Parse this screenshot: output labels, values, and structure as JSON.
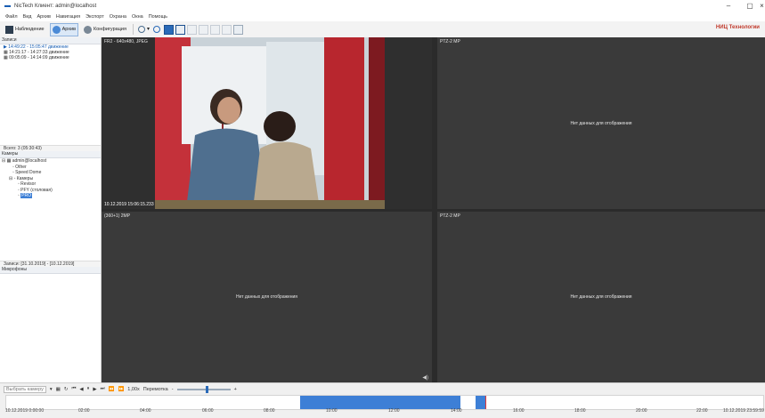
{
  "window": {
    "title": "NicTech Клиент: admin@localhost",
    "brand": "НИЦ Технологии"
  },
  "menu": [
    "Файл",
    "Вид",
    "Архив",
    "Навигация",
    "Экспорт",
    "Охрана",
    "Окна",
    "Помощь"
  ],
  "toolbar": {
    "observe": "Наблюдение",
    "archive": "Архив",
    "config": "Конфигурация"
  },
  "records": {
    "header": "Записи",
    "items": [
      "14:49:22 - 15:05:47 движение",
      "14:21:17 - 14:27:33 движение",
      "09:05:09 - 14:14:09 движение"
    ],
    "total": "Всего: 3 (05:30:43)"
  },
  "cameras": {
    "header": "Камеры",
    "tree": [
      "admin@localhost",
      "Other",
      "Speed Dome",
      "Камеры",
      "Revisor",
      "PFY (столовая)",
      "PRO"
    ],
    "range": "Записи: [31.10.2019] - [10.12.2019]",
    "mics": "Микрофоны"
  },
  "cells": [
    {
      "name": "FR2 - 640x480, JPEG",
      "timestamp": "10.12.2019 15:06:15.233"
    },
    {
      "name": "PTZ-2 MP",
      "nodata": "Нет данных для отображения"
    },
    {
      "name": "(360+1) 2MP",
      "nodata": "Нет данных для отображения"
    },
    {
      "name": "PTZ-2 MP",
      "nodata": "Нет данных для отображения"
    }
  ],
  "controls": {
    "select_camera": "Выбрать камеру",
    "speed": "1,00х",
    "rewind": "Перемотка"
  },
  "timeline": {
    "start": "10.12.2019 0:00:00",
    "end": "10.12.2019 23:59:59",
    "ticks": [
      "02:00",
      "04:00",
      "06:00",
      "08:00",
      "10:00",
      "12:00",
      "14:00",
      "16:00",
      "18:00",
      "20:00",
      "22:00"
    ]
  },
  "colors": {
    "accent": "#1a5fb4",
    "record": "#3d7fd6",
    "playhead": "#e53935",
    "grid_bg": "#3a3a3a"
  }
}
